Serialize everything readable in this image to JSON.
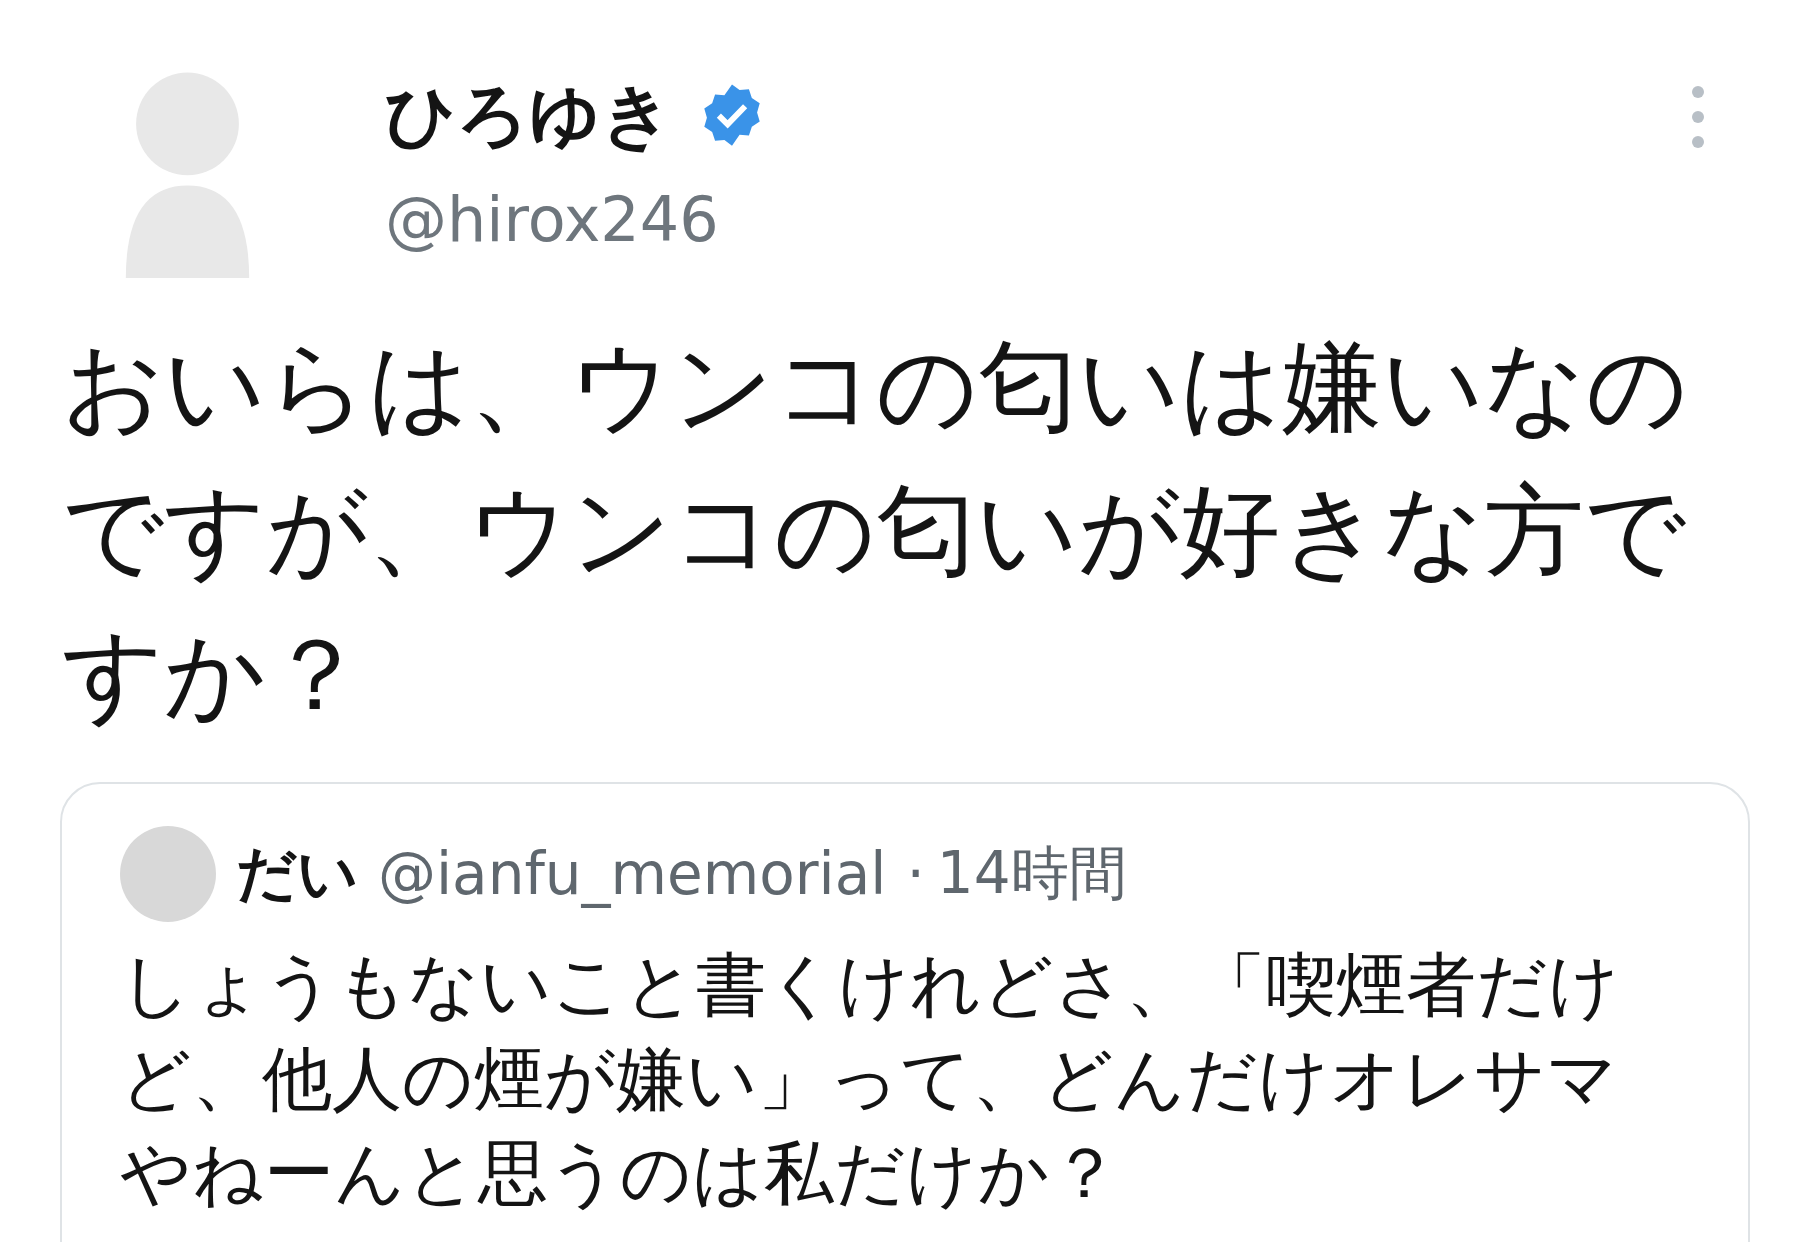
{
  "tweet": {
    "author": {
      "name": "ひろゆき",
      "verified": true,
      "handle": "@hirox246"
    },
    "text": "おいらは、ウンコの匂いは嫌いなのですが、ウンコの匂いが好きな方ですか？",
    "quoted_tweet": {
      "author": {
        "name": "だい",
        "handle": "@ianfu_memorial"
      },
      "separator": "·",
      "time": "14時間",
      "text": "しょうもないこと書くけれどさ、「喫煙者だけど、他人の煙が嫌い」って、どんだけオレサマやねーんと思うのは私だけか？"
    }
  }
}
